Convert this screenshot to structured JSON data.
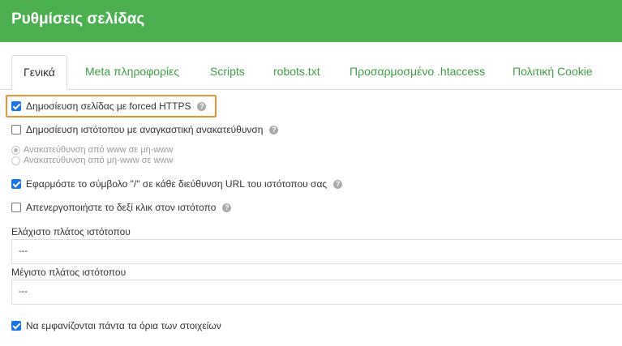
{
  "header": {
    "title": "Ρυθμίσεις σελίδας"
  },
  "tabs": [
    {
      "label": "Γενικά",
      "active": true
    },
    {
      "label": "Meta πληροφορίες"
    },
    {
      "label": "Scripts"
    },
    {
      "label": "robots.txt"
    },
    {
      "label": "Προσαρμοσμένο .htaccess"
    },
    {
      "label": "Πολιτική Cookie"
    }
  ],
  "options": {
    "forced_https": {
      "label": "Δημοσίευση σελίδας με forced HTTPS",
      "checked": true
    },
    "forced_redirect": {
      "label": "Δημοσίευση ιστότοπου με αναγκαστική ανακατεύθυνση",
      "checked": false
    },
    "redirect_www_to_nonwww": {
      "label": "Ανακατεύθυνση από www σε μη-www",
      "selected": true
    },
    "redirect_nonwww_to_www": {
      "label": "Ανακατεύθυνση από μη-www σε www",
      "selected": false
    },
    "trailing_slash": {
      "label": "Εφαρμόστε το σύμβολο \"/\" σε κάθε διεύθυνση URL του ιστότοπου σας",
      "checked": true
    },
    "disable_right_click": {
      "label": "Απενεργοποιήστε το δεξί κλικ στον ιστότοπο",
      "checked": false
    },
    "show_element_borders": {
      "label": "Να εμφανίζονται πάντα τα όρια των στοιχείων",
      "checked": true
    }
  },
  "fields": {
    "min_width": {
      "label": "Ελάχιστο πλάτος ιστότοπου",
      "value": "---"
    },
    "max_width": {
      "label": "Μέγιστο πλάτος ιστότοπου",
      "value": "---"
    }
  },
  "colors": {
    "header": "#4caf50",
    "tab_text": "#3f9e43",
    "highlight": "#e8952f",
    "checkbox": "#1a73e8"
  },
  "icons": {
    "help": "question-circle-icon"
  }
}
